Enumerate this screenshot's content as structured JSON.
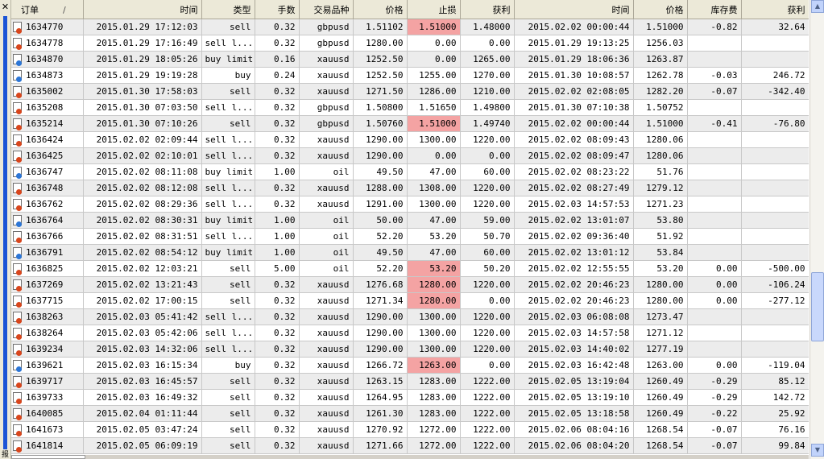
{
  "window": {
    "close_glyph": "✕",
    "side_label": "报"
  },
  "columns": [
    "订单",
    "时间",
    "类型",
    "手数",
    "交易品种",
    "价格",
    "止损",
    "获利",
    "时间",
    "价格",
    "库存费",
    "获利"
  ],
  "sort_indicator": "/",
  "colors": {
    "stoploss_highlight": "#f4a3a3",
    "selection_bar": "#1c55d6",
    "icon_sell": "#d9461c",
    "icon_buy": "#2c76d6"
  },
  "rows": [
    {
      "icon": "red",
      "order": "1634770",
      "open_time": "2015.01.29 17:12:03",
      "type": "sell",
      "lots": "0.32",
      "symbol": "gbpusd",
      "price": "1.51102",
      "sl": "1.51000",
      "tp": "1.48000",
      "close_time": "2015.02.02 00:00:44",
      "close_price": "1.51000",
      "swap": "-0.82",
      "profit": "32.64",
      "sl_hl": true
    },
    {
      "icon": "red",
      "order": "1634778",
      "open_time": "2015.01.29 17:16:49",
      "type": "sell l...",
      "lots": "0.32",
      "symbol": "gbpusd",
      "price": "1280.00",
      "sl": "0.00",
      "tp": "0.00",
      "close_time": "2015.01.29 19:13:25",
      "close_price": "1256.03",
      "swap": "",
      "profit": "",
      "sl_hl": false
    },
    {
      "icon": "blue",
      "order": "1634870",
      "open_time": "2015.01.29 18:05:26",
      "type": "buy limit",
      "lots": "0.16",
      "symbol": "xauusd",
      "price": "1252.50",
      "sl": "0.00",
      "tp": "1265.00",
      "close_time": "2015.01.29 18:06:36",
      "close_price": "1263.87",
      "swap": "",
      "profit": "",
      "sl_hl": false
    },
    {
      "icon": "blue",
      "order": "1634873",
      "open_time": "2015.01.29 19:19:28",
      "type": "buy",
      "lots": "0.24",
      "symbol": "xauusd",
      "price": "1252.50",
      "sl": "1255.00",
      "tp": "1270.00",
      "close_time": "2015.01.30 10:08:57",
      "close_price": "1262.78",
      "swap": "-0.03",
      "profit": "246.72",
      "sl_hl": false
    },
    {
      "icon": "red",
      "order": "1635002",
      "open_time": "2015.01.30 17:58:03",
      "type": "sell",
      "lots": "0.32",
      "symbol": "xauusd",
      "price": "1271.50",
      "sl": "1286.00",
      "tp": "1210.00",
      "close_time": "2015.02.02 02:08:05",
      "close_price": "1282.20",
      "swap": "-0.07",
      "profit": "-342.40",
      "sl_hl": false
    },
    {
      "icon": "red",
      "order": "1635208",
      "open_time": "2015.01.30 07:03:50",
      "type": "sell l...",
      "lots": "0.32",
      "symbol": "gbpusd",
      "price": "1.50800",
      "sl": "1.51650",
      "tp": "1.49800",
      "close_time": "2015.01.30 07:10:38",
      "close_price": "1.50752",
      "swap": "",
      "profit": "",
      "sl_hl": false
    },
    {
      "icon": "red",
      "order": "1635214",
      "open_time": "2015.01.30 07:10:26",
      "type": "sell",
      "lots": "0.32",
      "symbol": "gbpusd",
      "price": "1.50760",
      "sl": "1.51000",
      "tp": "1.49740",
      "close_time": "2015.02.02 00:00:44",
      "close_price": "1.51000",
      "swap": "-0.41",
      "profit": "-76.80",
      "sl_hl": true
    },
    {
      "icon": "red",
      "order": "1636424",
      "open_time": "2015.02.02 02:09:44",
      "type": "sell l...",
      "lots": "0.32",
      "symbol": "xauusd",
      "price": "1290.00",
      "sl": "1300.00",
      "tp": "1220.00",
      "close_time": "2015.02.02 08:09:43",
      "close_price": "1280.06",
      "swap": "",
      "profit": "",
      "sl_hl": false
    },
    {
      "icon": "red",
      "order": "1636425",
      "open_time": "2015.02.02 02:10:01",
      "type": "sell l...",
      "lots": "0.32",
      "symbol": "xauusd",
      "price": "1290.00",
      "sl": "0.00",
      "tp": "0.00",
      "close_time": "2015.02.02 08:09:47",
      "close_price": "1280.06",
      "swap": "",
      "profit": "",
      "sl_hl": false
    },
    {
      "icon": "blue",
      "order": "1636747",
      "open_time": "2015.02.02 08:11:08",
      "type": "buy limit",
      "lots": "1.00",
      "symbol": "oil",
      "price": "49.50",
      "sl": "47.00",
      "tp": "60.00",
      "close_time": "2015.02.02 08:23:22",
      "close_price": "51.76",
      "swap": "",
      "profit": "",
      "sl_hl": false
    },
    {
      "icon": "red",
      "order": "1636748",
      "open_time": "2015.02.02 08:12:08",
      "type": "sell l...",
      "lots": "0.32",
      "symbol": "xauusd",
      "price": "1288.00",
      "sl": "1308.00",
      "tp": "1220.00",
      "close_time": "2015.02.02 08:27:49",
      "close_price": "1279.12",
      "swap": "",
      "profit": "",
      "sl_hl": false
    },
    {
      "icon": "red",
      "order": "1636762",
      "open_time": "2015.02.02 08:29:36",
      "type": "sell l...",
      "lots": "0.32",
      "symbol": "xauusd",
      "price": "1291.00",
      "sl": "1300.00",
      "tp": "1220.00",
      "close_time": "2015.02.03 14:57:53",
      "close_price": "1271.23",
      "swap": "",
      "profit": "",
      "sl_hl": false
    },
    {
      "icon": "blue",
      "order": "1636764",
      "open_time": "2015.02.02 08:30:31",
      "type": "buy limit",
      "lots": "1.00",
      "symbol": "oil",
      "price": "50.00",
      "sl": "47.00",
      "tp": "59.00",
      "close_time": "2015.02.02 13:01:07",
      "close_price": "53.80",
      "swap": "",
      "profit": "",
      "sl_hl": false
    },
    {
      "icon": "red",
      "order": "1636766",
      "open_time": "2015.02.02 08:31:51",
      "type": "sell l...",
      "lots": "1.00",
      "symbol": "oil",
      "price": "52.20",
      "sl": "53.20",
      "tp": "50.70",
      "close_time": "2015.02.02 09:36:40",
      "close_price": "51.92",
      "swap": "",
      "profit": "",
      "sl_hl": false
    },
    {
      "icon": "blue",
      "order": "1636791",
      "open_time": "2015.02.02 08:54:12",
      "type": "buy limit",
      "lots": "1.00",
      "symbol": "oil",
      "price": "49.50",
      "sl": "47.00",
      "tp": "60.00",
      "close_time": "2015.02.02 13:01:12",
      "close_price": "53.84",
      "swap": "",
      "profit": "",
      "sl_hl": false
    },
    {
      "icon": "red",
      "order": "1636825",
      "open_time": "2015.02.02 12:03:21",
      "type": "sell",
      "lots": "5.00",
      "symbol": "oil",
      "price": "52.20",
      "sl": "53.20",
      "tp": "50.20",
      "close_time": "2015.02.02 12:55:55",
      "close_price": "53.20",
      "swap": "0.00",
      "profit": "-500.00",
      "sl_hl": true
    },
    {
      "icon": "red",
      "order": "1637269",
      "open_time": "2015.02.02 13:21:43",
      "type": "sell",
      "lots": "0.32",
      "symbol": "xauusd",
      "price": "1276.68",
      "sl": "1280.00",
      "tp": "1220.00",
      "close_time": "2015.02.02 20:46:23",
      "close_price": "1280.00",
      "swap": "0.00",
      "profit": "-106.24",
      "sl_hl": true
    },
    {
      "icon": "red",
      "order": "1637715",
      "open_time": "2015.02.02 17:00:15",
      "type": "sell",
      "lots": "0.32",
      "symbol": "xauusd",
      "price": "1271.34",
      "sl": "1280.00",
      "tp": "0.00",
      "close_time": "2015.02.02 20:46:23",
      "close_price": "1280.00",
      "swap": "0.00",
      "profit": "-277.12",
      "sl_hl": true
    },
    {
      "icon": "red",
      "order": "1638263",
      "open_time": "2015.02.03 05:41:42",
      "type": "sell l...",
      "lots": "0.32",
      "symbol": "xauusd",
      "price": "1290.00",
      "sl": "1300.00",
      "tp": "1220.00",
      "close_time": "2015.02.03 06:08:08",
      "close_price": "1273.47",
      "swap": "",
      "profit": "",
      "sl_hl": false
    },
    {
      "icon": "red",
      "order": "1638264",
      "open_time": "2015.02.03 05:42:06",
      "type": "sell l...",
      "lots": "0.32",
      "symbol": "xauusd",
      "price": "1290.00",
      "sl": "1300.00",
      "tp": "1220.00",
      "close_time": "2015.02.03 14:57:58",
      "close_price": "1271.12",
      "swap": "",
      "profit": "",
      "sl_hl": false
    },
    {
      "icon": "red",
      "order": "1639234",
      "open_time": "2015.02.03 14:32:06",
      "type": "sell l...",
      "lots": "0.32",
      "symbol": "xauusd",
      "price": "1290.00",
      "sl": "1300.00",
      "tp": "1220.00",
      "close_time": "2015.02.03 14:40:02",
      "close_price": "1277.19",
      "swap": "",
      "profit": "",
      "sl_hl": false
    },
    {
      "icon": "blue",
      "order": "1639621",
      "open_time": "2015.02.03 16:15:34",
      "type": "buy",
      "lots": "0.32",
      "symbol": "xauusd",
      "price": "1266.72",
      "sl": "1263.00",
      "tp": "0.00",
      "close_time": "2015.02.03 16:42:48",
      "close_price": "1263.00",
      "swap": "0.00",
      "profit": "-119.04",
      "sl_hl": true
    },
    {
      "icon": "red",
      "order": "1639717",
      "open_time": "2015.02.03 16:45:57",
      "type": "sell",
      "lots": "0.32",
      "symbol": "xauusd",
      "price": "1263.15",
      "sl": "1283.00",
      "tp": "1222.00",
      "close_time": "2015.02.05 13:19:04",
      "close_price": "1260.49",
      "swap": "-0.29",
      "profit": "85.12",
      "sl_hl": false
    },
    {
      "icon": "red",
      "order": "1639733",
      "open_time": "2015.02.03 16:49:32",
      "type": "sell",
      "lots": "0.32",
      "symbol": "xauusd",
      "price": "1264.95",
      "sl": "1283.00",
      "tp": "1222.00",
      "close_time": "2015.02.05 13:19:10",
      "close_price": "1260.49",
      "swap": "-0.29",
      "profit": "142.72",
      "sl_hl": false
    },
    {
      "icon": "red",
      "order": "1640085",
      "open_time": "2015.02.04 01:11:44",
      "type": "sell",
      "lots": "0.32",
      "symbol": "xauusd",
      "price": "1261.30",
      "sl": "1283.00",
      "tp": "1222.00",
      "close_time": "2015.02.05 13:18:58",
      "close_price": "1260.49",
      "swap": "-0.22",
      "profit": "25.92",
      "sl_hl": false
    },
    {
      "icon": "red",
      "order": "1641673",
      "open_time": "2015.02.05 03:47:24",
      "type": "sell",
      "lots": "0.32",
      "symbol": "xauusd",
      "price": "1270.92",
      "sl": "1272.00",
      "tp": "1222.00",
      "close_time": "2015.02.06 08:04:16",
      "close_price": "1268.54",
      "swap": "-0.07",
      "profit": "76.16",
      "sl_hl": false
    },
    {
      "icon": "red",
      "order": "1641814",
      "open_time": "2015.02.05 06:09:19",
      "type": "sell",
      "lots": "0.32",
      "symbol": "xauusd",
      "price": "1271.66",
      "sl": "1272.00",
      "tp": "1222.00",
      "close_time": "2015.02.06 08:04:20",
      "close_price": "1268.54",
      "swap": "-0.07",
      "profit": "99.84",
      "sl_hl": false
    }
  ]
}
